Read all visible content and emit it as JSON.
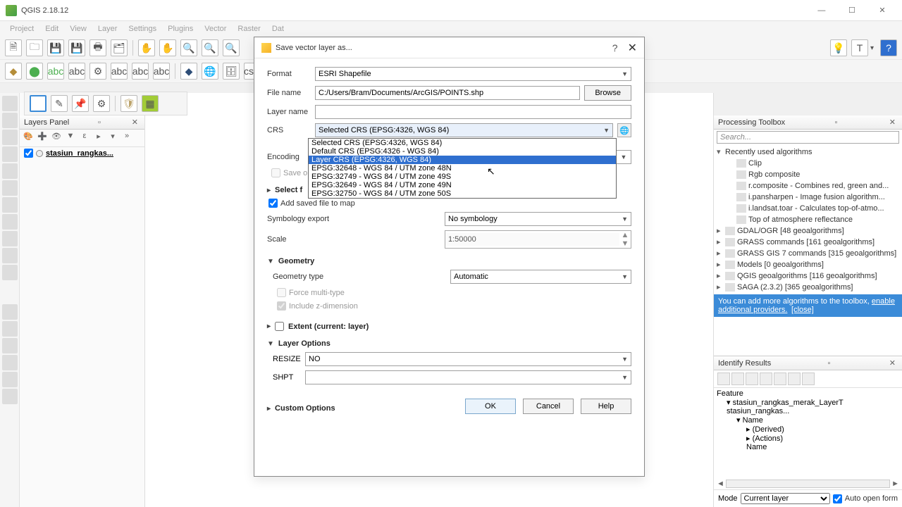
{
  "app": {
    "title": "QGIS 2.18.12"
  },
  "menu": [
    "Project",
    "Edit",
    "View",
    "Layer",
    "Settings",
    "Plugins",
    "Vector",
    "Raster",
    "Dat"
  ],
  "layers_panel": {
    "title": "Layers Panel",
    "layer": "stasiun_rangkas..."
  },
  "dialog": {
    "title": "Save vector layer as...",
    "format_lbl": "Format",
    "format_val": "ESRI Shapefile",
    "filename_lbl": "File name",
    "filename_val": "C:/Users/Bram/Documents/ArcGIS/POINTS.shp",
    "browse": "Browse",
    "layername_lbl": "Layer name",
    "layername_val": "",
    "crs_lbl": "CRS",
    "crs_val": "Selected CRS (EPSG:4326, WGS 84)",
    "crs_options": [
      "Selected CRS (EPSG:4326, WGS 84)",
      "Default CRS (EPSG:4326 - WGS 84)",
      "Layer CRS (EPSG:4326, WGS 84)",
      "EPSG:32648 - WGS 84 / UTM zone 48N",
      "EPSG:32749 - WGS 84 / UTM zone 49S",
      "EPSG:32649 - WGS 84 / UTM zone 49N",
      "EPSG:32750 - WGS 84 / UTM zone 50S"
    ],
    "crs_hl_index": 2,
    "encoding_lbl": "Encoding",
    "save_only_lbl": "Save onl",
    "select_fields_lbl": "Select f",
    "add_saved_lbl": "Add saved file to map",
    "symb_lbl": "Symbology export",
    "symb_val": "No symbology",
    "scale_lbl": "Scale",
    "scale_val": "1:50000",
    "geom_hdr": "Geometry",
    "geom_type_lbl": "Geometry type",
    "geom_type_val": "Automatic",
    "force_multi": "Force multi-type",
    "include_z": "Include z-dimension",
    "extent_hdr": "Extent (current: layer)",
    "layer_opts_hdr": "Layer Options",
    "resize_lbl": "RESIZE",
    "resize_val": "NO",
    "shpt_lbl": "SHPT",
    "shpt_val": "",
    "custom_hdr": "Custom Options",
    "ok": "OK",
    "cancel": "Cancel",
    "help": "Help"
  },
  "proc": {
    "title": "Processing Toolbox",
    "search_ph": "Search...",
    "recent": "Recently used algorithms",
    "items_recent": [
      "Clip",
      "Rgb composite",
      "r.composite - Combines red, green and...",
      "i.pansharpen - Image fusion algorithm...",
      "i.landsat.toar - Calculates top-of-atmo...",
      "Top of atmosphere reflectance"
    ],
    "groups": [
      "GDAL/OGR [48 geoalgorithms]",
      "GRASS commands [161 geoalgorithms]",
      "GRASS GIS 7 commands [315 geoalgorithms]",
      "Models [0 geoalgorithms]",
      "QGIS geoalgorithms [116 geoalgorithms]",
      "SAGA (2.3.2) [365 geoalgorithms]"
    ],
    "hint_pre": "You can add more algorithms to the toolbox, ",
    "hint_link1": "enable additional providers.",
    "hint_link2": "[close]"
  },
  "identify": {
    "title": "Identify Results",
    "feature": "Feature",
    "root": "stasiun_rangkas_merak_LayerT stasiun_rangkas...",
    "name": "Name",
    "derived": "(Derived)",
    "actions": "(Actions)",
    "name2": "Name",
    "mode": "Mode",
    "mode_val": "Current layer",
    "auto_open": "Auto open form"
  }
}
